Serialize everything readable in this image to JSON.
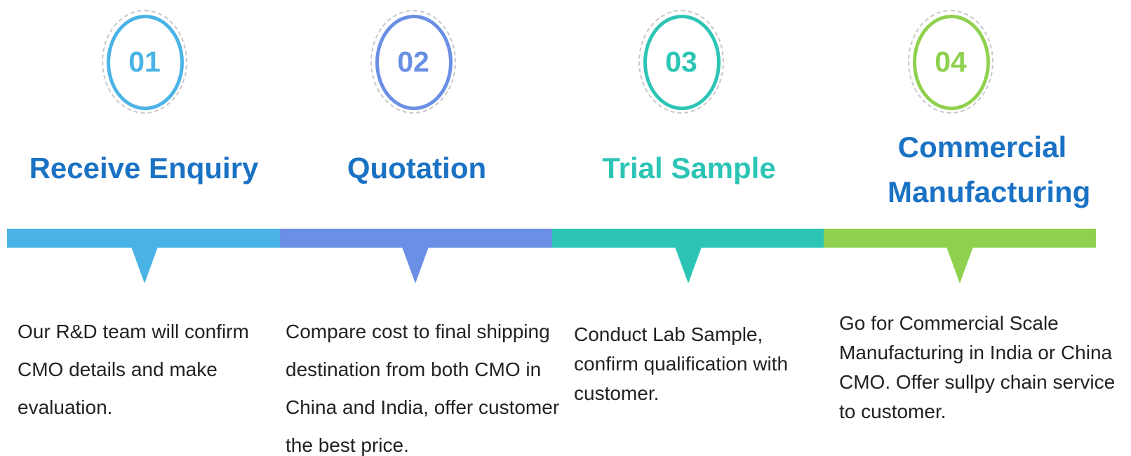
{
  "steps": [
    {
      "number": "01",
      "title": "Receive  Enquiry",
      "description": "Our R&D team will confirm CMO details and make evaluation.",
      "color": "#4ab3e6",
      "title_color": "#1a72c4"
    },
    {
      "number": "02",
      "title": "Quotation",
      "description": "Compare cost to final shipping destination from both CMO in China and India, offer customer the best price.",
      "color": "#6a8fe4",
      "title_color": "#1a72c4"
    },
    {
      "number": "03",
      "title": "Trial Sample",
      "description": "Conduct Lab Sample, confirm qualification with customer.",
      "color": "#2cc5b5",
      "title_color": "#2cc5b5"
    },
    {
      "number": "04",
      "title": "Commercial Manufacturing",
      "description": "Go for Commercial Scale Manufacturing in India or China CMO. Offer sullpy chain service to customer.",
      "color": "#8fd14f",
      "title_color": "#1a72c4"
    }
  ]
}
